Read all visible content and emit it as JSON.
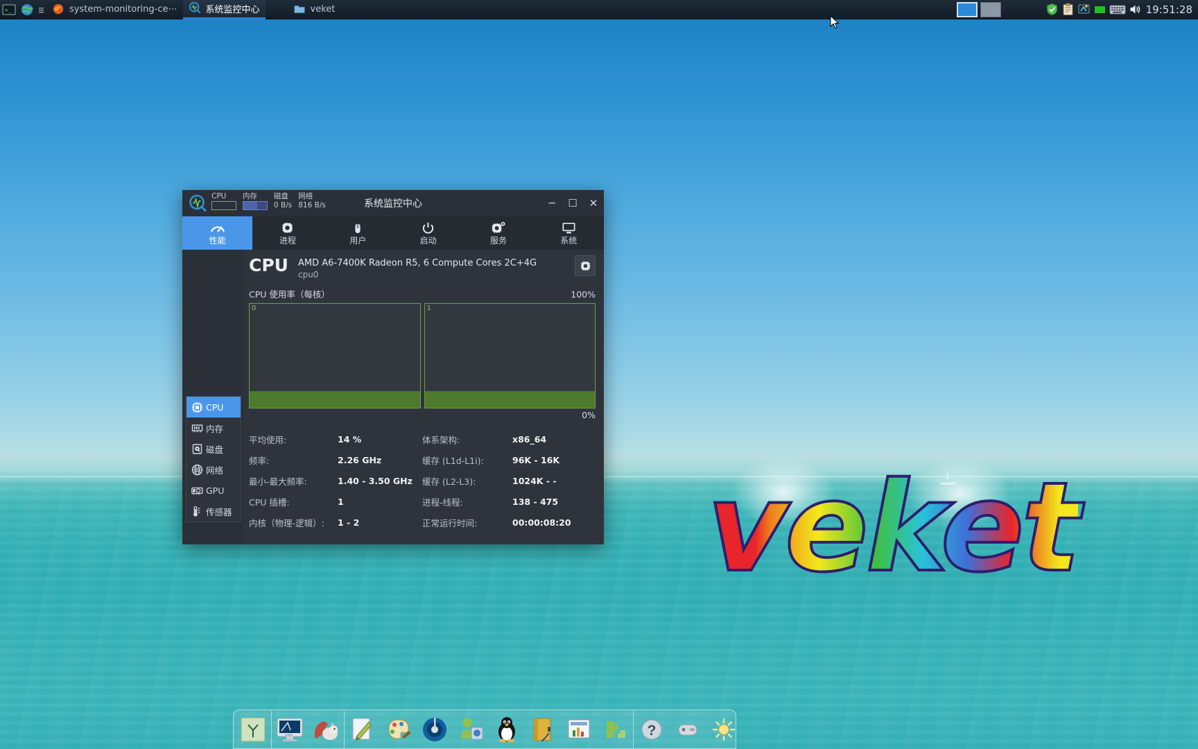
{
  "taskbar": {
    "icons": [
      "terminal-icon",
      "globe-icon",
      "menu-icon",
      "firefox-icon"
    ],
    "tasks": [
      {
        "icon": "firefox-icon",
        "label": "system-monitoring-ce⋯",
        "active": false
      },
      {
        "icon": "monitor-search-icon",
        "label": "系统监控中心",
        "active": true
      },
      {
        "icon": "folder-icon",
        "label": "veket",
        "active": false
      }
    ],
    "workspaces": [
      {
        "name": "workspace-1",
        "selected": true
      },
      {
        "name": "workspace-2",
        "selected": false
      }
    ],
    "tray": [
      "shield-icon",
      "clipboard-icon",
      "network-icon",
      "green-square-icon",
      "keyboard-icon",
      "volume-icon"
    ],
    "clock": "19:51:28"
  },
  "desktop": {
    "logo_text": "veket"
  },
  "dock": {
    "items": [
      "notepad-tree-icon",
      "imac-veket-icon",
      "squirrel-icon",
      "text-editor-icon",
      "paint-palette-icon",
      "media-player-icon",
      "user-profile-icon",
      "tux-linux-icon",
      "folder-open-icon",
      "spreadsheet-icon",
      "green-puzzle-icon",
      "help-question-icon",
      "mouse-device-icon",
      "brightness-icon"
    ]
  },
  "window": {
    "title": "系统监控中心",
    "app_icon": "monitor-search-icon",
    "meters": [
      {
        "label": "CPU",
        "type": "bar",
        "color": "#7ab648",
        "fill_pct": 5
      },
      {
        "label": "内存",
        "type": "bar",
        "color": "#6a7fd0",
        "fill_pct": 58
      },
      {
        "label": "磁盘",
        "type": "text",
        "value": "0 B/s"
      },
      {
        "label": "网络",
        "type": "text",
        "value": "816 B/s"
      }
    ],
    "controls": {
      "minimize": "─",
      "maximize": "☐",
      "close": "✕"
    },
    "tabs": [
      {
        "label": "性能",
        "icon": "gauge-icon",
        "active": true
      },
      {
        "label": "进程",
        "icon": "gear-icon",
        "active": false
      },
      {
        "label": "用户",
        "icon": "mouse-icon",
        "active": false
      },
      {
        "label": "启动",
        "icon": "power-icon",
        "active": false
      },
      {
        "label": "服务",
        "icon": "gear-degree-icon",
        "active": false
      },
      {
        "label": "系统",
        "icon": "desktop-icon",
        "active": false
      }
    ],
    "sidebar": [
      {
        "label": "CPU",
        "icon": "chip-icon",
        "active": true
      },
      {
        "label": "内存",
        "icon": "ram-icon",
        "active": false
      },
      {
        "label": "磁盘",
        "icon": "harddisk-icon",
        "active": false
      },
      {
        "label": "网络",
        "icon": "globe-icon",
        "active": false
      },
      {
        "label": "GPU",
        "icon": "gpu-card-icon",
        "active": false
      },
      {
        "label": "传感器",
        "icon": "thermometer-icon",
        "active": false
      }
    ],
    "cpu": {
      "heading": "CPU",
      "model": "AMD A6-7400K Radeon R5, 6 Compute Cores 2C+4G",
      "device": "cpu0",
      "settings_icon": "gear-icon",
      "usage_label": "CPU 使用率（每核）",
      "axis_max": "100%",
      "axis_min": "0%"
    },
    "stats_left": [
      {
        "key": "平均使用:",
        "value": "14 %"
      },
      {
        "key": "频率:",
        "value": "2.26 GHz"
      },
      {
        "key": "最小-最大频率:",
        "value": "1.40 - 3.50 GHz"
      },
      {
        "key": "CPU 插槽:",
        "value": "1"
      },
      {
        "key": "内核（物理-逻辑）:",
        "value": "1 - 2"
      }
    ],
    "stats_right": [
      {
        "key": "体系架构:",
        "value": "x86_64"
      },
      {
        "key": "缓存 (L1d-L1i):",
        "value": "96K - 16K"
      },
      {
        "key": "缓存 (L2-L3):",
        "value": "1024K - -"
      },
      {
        "key": "进程-线程:",
        "value": "138 - 475"
      },
      {
        "key": "正常运行时间:",
        "value": "00:00:08:20"
      }
    ]
  },
  "chart_data": {
    "type": "bar",
    "title": "CPU 使用率（每核）",
    "categories": [
      "0",
      "1"
    ],
    "values": [
      16,
      16
    ],
    "ylabel": "",
    "xlabel": "",
    "ylim": [
      0,
      100
    ],
    "tick_labels": [
      "0%",
      "100%"
    ],
    "series_color": "#4d7a2c",
    "grid": false,
    "legend": "none"
  },
  "colors": {
    "accent": "#4a97ea",
    "window_bg": "#2f343c",
    "titlebar_bg": "#2b3038",
    "graph_border": "#6e9e44",
    "graph_fill": "#4d7a2c"
  }
}
